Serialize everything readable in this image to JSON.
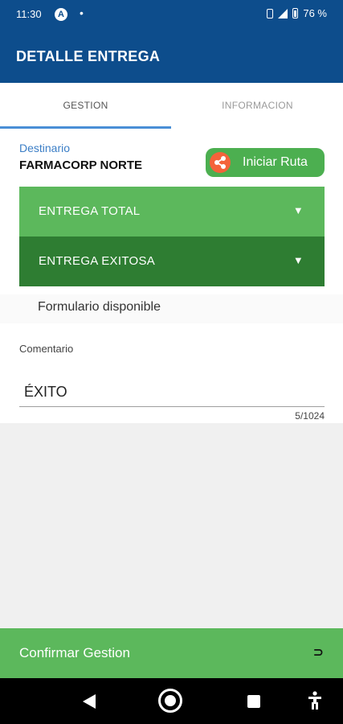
{
  "status_bar": {
    "time": "11:30",
    "app_badge": "A",
    "battery": "76 %"
  },
  "app_bar": {
    "title": "DETALLE ENTREGA"
  },
  "tabs": [
    {
      "label": "GESTION",
      "selected": true
    },
    {
      "label": "INFORMACION",
      "selected": false
    }
  ],
  "destination": {
    "label": "Destinario",
    "value": "FARMACORP NORTE"
  },
  "route_button": {
    "label": "Iniciar Ruta",
    "icon": "share-icon"
  },
  "dropdowns": [
    {
      "selected": "ENTREGA TOTAL"
    },
    {
      "selected": "ENTREGA EXITOSA"
    }
  ],
  "form_available": "Formulario disponible",
  "comment": {
    "label": "Comentario",
    "value": "ÉXITO",
    "counter": "5/1024"
  },
  "confirm": {
    "label": "Confirmar Gestion",
    "icon": "undo-icon"
  },
  "colors": {
    "primary": "#0d4d8c",
    "accent_green": "#5cb85c",
    "dark_green": "#2e7d32",
    "route_icon": "#f4633a",
    "tab_indicator": "#4a8fd6"
  }
}
